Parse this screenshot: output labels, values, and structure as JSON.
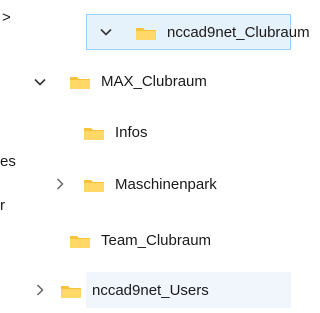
{
  "left_fragments": [
    ">",
    "es",
    "r"
  ],
  "tree": {
    "items": [
      {
        "label": "nccad9net_Clubraum",
        "expanded": true,
        "selected": true,
        "icon": "folder-icon",
        "chevron": "chevron-down-icon"
      },
      {
        "label": "MAX_Clubraum",
        "expanded": true,
        "icon": "folder-icon",
        "chevron": "chevron-down-icon"
      },
      {
        "label": "Infos",
        "icon": "folder-icon"
      },
      {
        "label": "Maschinenpark",
        "expanded": false,
        "icon": "folder-icon",
        "chevron": "chevron-right-icon"
      },
      {
        "label": "Team_Clubraum",
        "icon": "folder-icon"
      },
      {
        "label": "nccad9net_Users",
        "expanded": false,
        "hover": true,
        "icon": "folder-icon",
        "chevron": "chevron-right-icon"
      }
    ]
  },
  "colors": {
    "selection_bg": "#e5f1fb",
    "selection_border": "#99d1ff",
    "folder_yellow": "#f8c33a"
  }
}
